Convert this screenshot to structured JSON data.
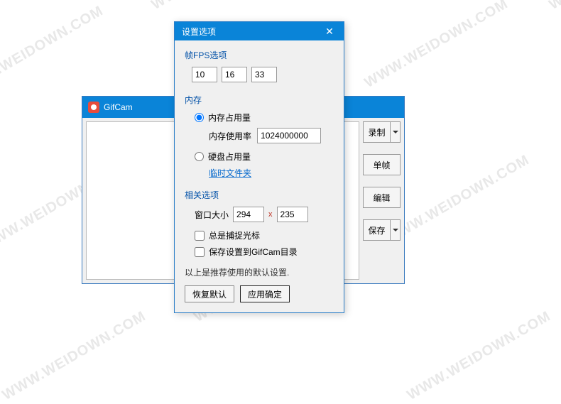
{
  "watermark": "WWW.WEIDOWN.COM",
  "gifcam": {
    "title": "GifCam",
    "buttons": {
      "record": "录制",
      "frame": "单帧",
      "edit": "编辑",
      "save": "保存"
    }
  },
  "settings": {
    "title": "设置选项",
    "close": "✕",
    "fps": {
      "label": "帧FPS选项",
      "v1": "10",
      "v2": "16",
      "v3": "33"
    },
    "memory": {
      "label": "内存",
      "opt_mem": "内存占用量",
      "usage_label": "内存使用率",
      "usage_value": "1024000000",
      "opt_disk": "硬盘占用量",
      "temp_link": "临时文件夹"
    },
    "related": {
      "label": "相关选项",
      "win_size_label": "窗口大小",
      "width": "294",
      "height": "235",
      "x": "x",
      "chk_cursor": "总是捕捉光标",
      "chk_save": "保存设置到GifCam目录"
    },
    "footer": "以上是推荐使用的默认设置.",
    "btn_restore": "恢复默认",
    "btn_apply": "应用确定"
  }
}
